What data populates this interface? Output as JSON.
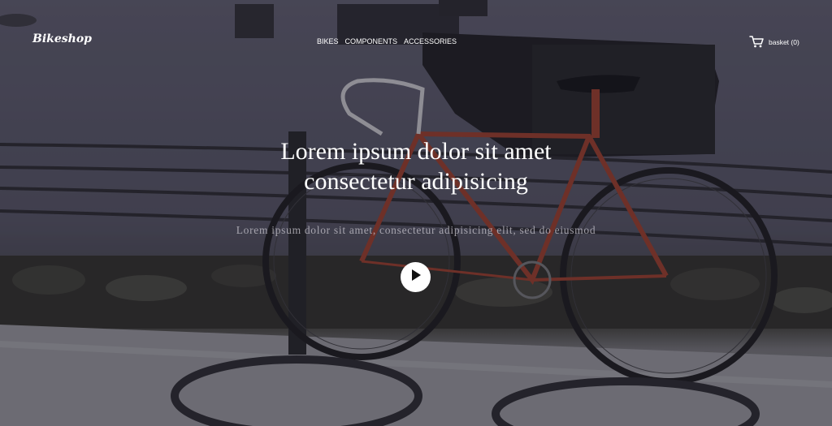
{
  "brand": {
    "name": "Bikeshop"
  },
  "nav": {
    "items": [
      {
        "label": "BIKES"
      },
      {
        "label": "COMPONENTS"
      },
      {
        "label": "ACCESSORIES"
      }
    ]
  },
  "basket": {
    "label": "basket (0)",
    "icon": "cart-icon"
  },
  "hero": {
    "headline_line1": "Lorem ipsum dolor sit amet",
    "headline_line2": "consectetur adipisicing",
    "subtitle": "Lorem ipsum dolor sit amet, consectetur adipisicing elit, sed do eiusmod",
    "play_icon": "play-icon"
  },
  "colors": {
    "text": "#ffffff",
    "play_button": "#ffffff",
    "bike_frame": "#8c3a2c"
  }
}
